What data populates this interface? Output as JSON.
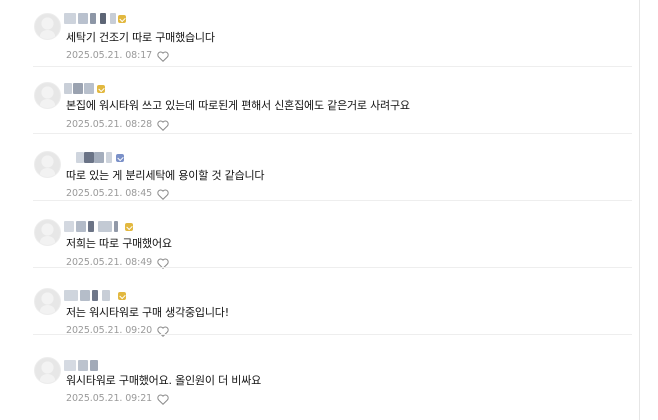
{
  "comments": [
    {
      "text": "세탁기 건조기 따로 구매했습니다",
      "date": "2025.05.21. 08:17",
      "like_icon": "heart-outline-icon"
    },
    {
      "text": "본집에 워시타워 쓰고 있는데 따로된게 편해서 신혼집에도 같은거로 사려구요",
      "date": "2025.05.21. 08:28",
      "like_icon": "heart-outline-icon"
    },
    {
      "text": "따로 있는 게 분리세탁에 용이할 것 같습니다",
      "date": "2025.05.21. 08:45",
      "like_icon": "heart-outline-icon"
    },
    {
      "text": "저희는 따로 구매했어요",
      "date": "2025.05.21. 08:49",
      "like_icon": "heart-outline-icon"
    },
    {
      "text": "저는 워시타워로 구매 생각중입니다!",
      "date": "2025.05.21. 09:20",
      "like_icon": "heart-outline-icon"
    },
    {
      "text": "워시타워로 구매했어요. 올인원이 더 비싸요",
      "date": "2025.05.21. 09:21",
      "like_icon": "heart-outline-icon"
    }
  ],
  "colors": {
    "text": "#111111",
    "date": "#9a9a9a",
    "badge": "#e2b83f",
    "divider": "#eeeeee"
  }
}
